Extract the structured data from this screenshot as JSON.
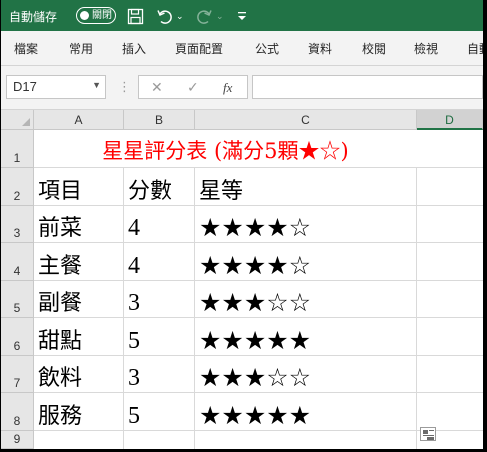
{
  "titlebar": {
    "autosave_label": "自動儲存",
    "autosave_state": "關閉",
    "icons": [
      "save-icon",
      "undo-icon",
      "redo-icon",
      "customize-toolbar-icon"
    ],
    "accent_color": "#217346"
  },
  "ribbon": {
    "tabs": [
      "檔案",
      "常用",
      "插入",
      "頁面配置",
      "公式",
      "資料",
      "校閱",
      "檢視",
      "自動"
    ]
  },
  "formula_bar": {
    "name_box": "D17",
    "cancel_glyph": "✕",
    "enter_glyph": "✓",
    "fx_label": "fx",
    "content": ""
  },
  "sheet": {
    "columns": [
      "A",
      "B",
      "C",
      "D"
    ],
    "active_column": "D",
    "rows": [
      "1",
      "2",
      "3",
      "4",
      "5",
      "6",
      "7",
      "8",
      "9"
    ],
    "title": "星星評分表 (滿分5顆★☆)",
    "title_color": "#ff0000",
    "header": {
      "item": "項目",
      "score": "分數",
      "stars": "星等"
    },
    "data": [
      {
        "item": "前菜",
        "score": "4",
        "stars": "★★★★☆"
      },
      {
        "item": "主餐",
        "score": "4",
        "stars": "★★★★☆"
      },
      {
        "item": "副餐",
        "score": "3",
        "stars": "★★★☆☆"
      },
      {
        "item": "甜點",
        "score": "5",
        "stars": "★★★★★"
      },
      {
        "item": "飲料",
        "score": "3",
        "stars": "★★★☆☆"
      },
      {
        "item": "服務",
        "score": "5",
        "stars": "★★★★★"
      }
    ]
  }
}
